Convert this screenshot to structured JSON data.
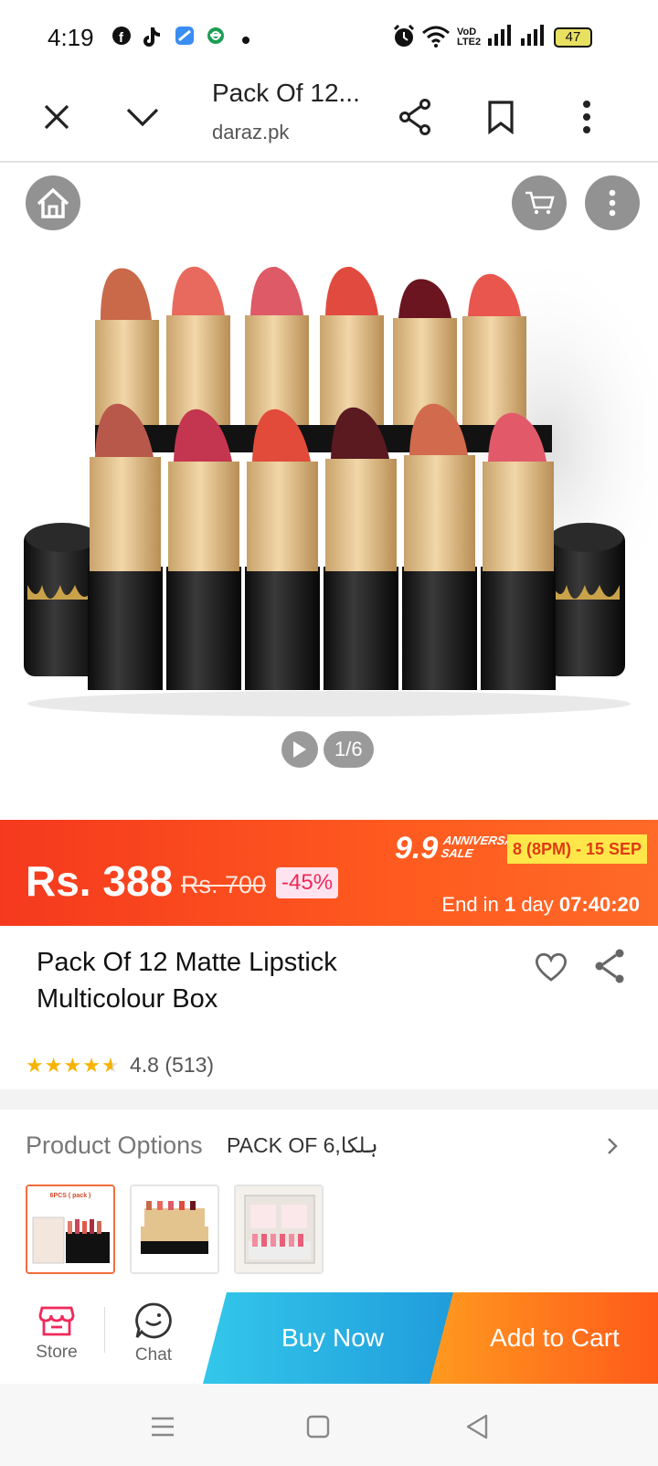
{
  "status_bar": {
    "time": "4:19",
    "volte_label": "VoD LTE2",
    "battery": "47",
    "app_icons": [
      "facebook-icon",
      "tiktok-icon",
      "browser-icon",
      "edge-icon"
    ]
  },
  "toolbar": {
    "title": "Pack Of 12...",
    "domain": "daraz.pk"
  },
  "gallery": {
    "counter": "1/6"
  },
  "price": {
    "current": "Rs. 388",
    "original": "Rs. 700",
    "discount": "-45%",
    "sale_num": "9.9",
    "sale_line1": "ANNIVERSARY",
    "sale_line2": "SALE",
    "sale_dates": "8 (8PM) - 15 SEP",
    "ends_prefix": "End in",
    "ends_days": "1",
    "ends_day_word": "day",
    "ends_time": "07:40:20"
  },
  "product": {
    "name": "Pack Of 12 Matte Lipstick Multicolour Box",
    "rating_text": "4.8  (513)",
    "rating": 4.8,
    "review_count": 513
  },
  "options": {
    "label": "Product Options",
    "value": "PACK OF 6,ہلکا",
    "thumb1_text": "6PCS ( pack )"
  },
  "actions": {
    "store": "Store",
    "chat": "Chat",
    "buy_now": "Buy Now",
    "add_to_cart": "Add to Cart"
  },
  "colors": {
    "price_banner": "#f5391e",
    "buy_now": "#1f9bdb",
    "add_to_cart": "#ff6a1f",
    "store_icon": "#f0285a"
  }
}
